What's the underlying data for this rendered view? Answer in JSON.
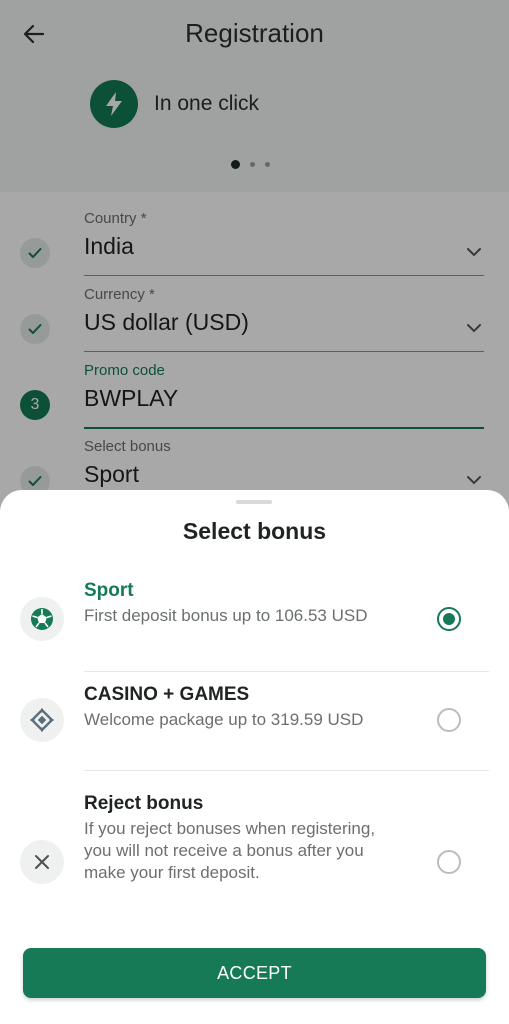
{
  "header": {
    "title": "Registration",
    "back_icon": "arrow-left-icon",
    "one_click_label": "In one click",
    "one_click_icon": "lightning-bolt-icon",
    "pager": {
      "count": 3,
      "active": 1
    }
  },
  "form": {
    "country": {
      "label": "Country *",
      "value": "India"
    },
    "currency": {
      "label": "Currency *",
      "value": "US dollar (USD)"
    },
    "promo": {
      "label": "Promo code",
      "value": "BWPLAY",
      "step": "3"
    },
    "bonus": {
      "label": "Select bonus",
      "value": "Sport"
    }
  },
  "sheet": {
    "title": "Select bonus",
    "options": [
      {
        "title": "Sport",
        "desc": "First deposit bonus up to 106.53 USD",
        "icon": "soccer-ball-icon",
        "selected": true
      },
      {
        "title": "CASINO + GAMES",
        "desc": "Welcome package up to 319.59 USD",
        "icon": "casino-chip-icon",
        "selected": false
      },
      {
        "title": "Reject bonus",
        "desc": "If you reject bonuses when registering, you will not receive a bonus after you make your first deposit.",
        "icon": "close-icon",
        "selected": false
      }
    ],
    "accept_label": "ACCEPT"
  },
  "colors": {
    "accent": "#157a55",
    "overlay": "rgba(0,0,0,0.34)"
  }
}
